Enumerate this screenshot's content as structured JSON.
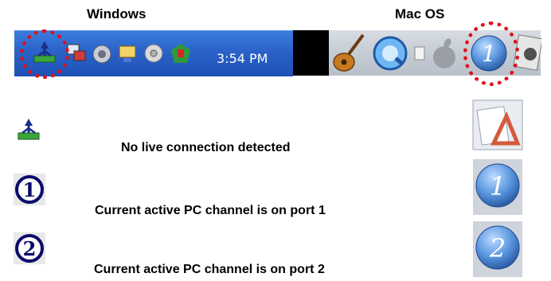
{
  "header": {
    "windows_label": "Windows",
    "mac_label": "Mac OS"
  },
  "windows_taskbar": {
    "clock": "3:54 PM",
    "icons": [
      "usb-network-icon",
      "network-monitor-icon",
      "speaker-icon",
      "display-icon",
      "settings-icon",
      "security-icon"
    ]
  },
  "mac_dock": {
    "icons": [
      "guitar-icon",
      "quicktime-icon",
      "finder-icon",
      "apple-icon",
      "port-one-icon",
      "photo-icon"
    ]
  },
  "legend": {
    "items": [
      {
        "icon": "no-connection-icon",
        "text": "No live connection detected",
        "mac_icon": "mac-no-connection-icon"
      },
      {
        "icon": "port-1-icon",
        "text": "Current active PC channel is on port 1",
        "mac_icon": "mac-port-1-icon"
      },
      {
        "icon": "port-2-icon",
        "text": "Current active PC channel is on port 2",
        "mac_icon": "mac-port-2-icon"
      }
    ]
  },
  "port_numbers": {
    "one": "1",
    "two": "2"
  },
  "colors": {
    "win_taskbar": "#2a62c8",
    "mac_dock": "#c6ccd4",
    "highlight_circle": "#e0101c"
  }
}
